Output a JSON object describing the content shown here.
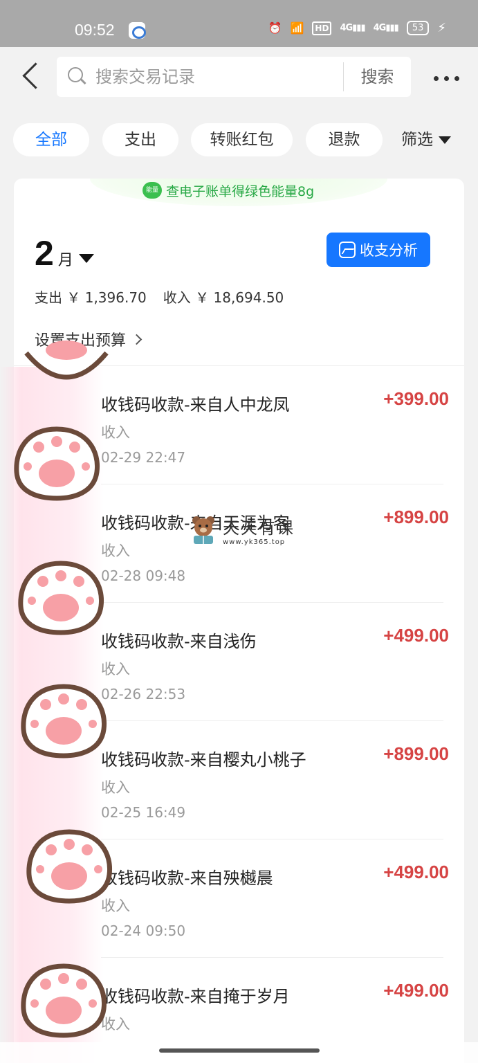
{
  "status_bar": {
    "time": "09:52",
    "hd": "HD",
    "signal1": "4G",
    "signal2": "4G",
    "battery": "53"
  },
  "header": {
    "search_placeholder": "搜索交易记录",
    "search_button": "搜索"
  },
  "filters": {
    "all": "全部",
    "expense": "支出",
    "transfer": "转账红包",
    "refund": "退款",
    "filter": "筛选"
  },
  "energy_banner": {
    "badge": "能量",
    "text": "查电子账单得绿色能量8g"
  },
  "summary": {
    "month": "2",
    "month_unit": "月",
    "analysis_button": "收支分析",
    "expense_label": "支出 ￥ 1,396.70",
    "income_label": "收入 ￥ 18,694.50",
    "budget_link": "设置支出预算"
  },
  "transactions": [
    {
      "title": "收钱码收款-来自人中龙凤",
      "type": "收入",
      "date": "02-29 22:47",
      "amount": "+399.00"
    },
    {
      "title": "收钱码收款-来自天涯为客",
      "type": "收入",
      "date": "02-28 09:48",
      "amount": "+899.00"
    },
    {
      "title": "收钱码收款-来自浅伤",
      "type": "收入",
      "date": "02-26 22:53",
      "amount": "+499.00"
    },
    {
      "title": "收钱码收款-来自樱丸小桃子",
      "type": "收入",
      "date": "02-25 16:49",
      "amount": "+899.00"
    },
    {
      "title": "收钱码收款-来自殃樾晨",
      "type": "收入",
      "date": "02-24 09:50",
      "amount": "+499.00"
    },
    {
      "title": "收钱码收款-来自掩于岁月",
      "type": "收入",
      "date": "",
      "amount": "+499.00"
    }
  ],
  "watermark": {
    "title": "天天有课",
    "url": "www.yk365.top"
  },
  "colors": {
    "accent": "#1677ff",
    "income": "#d64444",
    "energy": "#27a845"
  }
}
